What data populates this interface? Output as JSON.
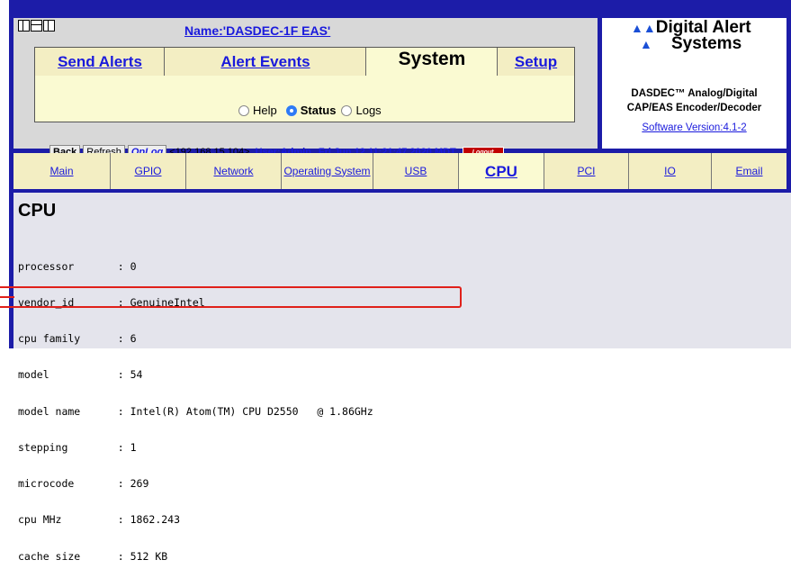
{
  "header": {
    "name_link": "Name:'DASDEC-1F EAS'",
    "tabs": [
      {
        "label": "Send Alerts",
        "selected": false
      },
      {
        "label": "Alert Events",
        "selected": false
      },
      {
        "label": "System",
        "selected": true
      },
      {
        "label": "Setup",
        "selected": false
      }
    ],
    "radios": [
      {
        "label": "Help",
        "checked": false
      },
      {
        "label": "Status",
        "checked": true
      },
      {
        "label": "Logs",
        "checked": false
      }
    ],
    "nav": {
      "back": "Back",
      "refresh": "Refresh",
      "oplog": "OpLog",
      "ip": "<192.168.15.104>",
      "user": "User:Admin",
      "datetime": "Fri Jun 12 11:21:47 2020 MDT",
      "logout": "Logout"
    }
  },
  "brand": {
    "logo_line1": "Digital Alert",
    "logo_line2": "Systems",
    "product_line1": "DASDEC™ Analog/Digital",
    "product_line2": "CAP/EAS Encoder/Decoder",
    "version": "Software Version:4.1-2"
  },
  "subnav": {
    "items": [
      {
        "label": "Main"
      },
      {
        "label": "GPIO"
      },
      {
        "label": "Network"
      },
      {
        "label": "Operating System"
      },
      {
        "label": "USB"
      },
      {
        "label": "CPU",
        "selected": true
      },
      {
        "label": "PCI"
      },
      {
        "label": "IO"
      },
      {
        "label": "Email"
      }
    ]
  },
  "content": {
    "title": "CPU",
    "lines": [
      "processor       : 0",
      "vendor_id       : GenuineIntel",
      "cpu family      : 6",
      "model           : 54",
      "model name      : Intel(R) Atom(TM) CPU D2550   @ 1.86GHz",
      "stepping        : 1",
      "microcode       : 269",
      "cpu MHz         : 1862.243",
      "cache size      : 512 KB"
    ]
  },
  "colors": {
    "frame_blue": "#1c1ca8",
    "link_blue": "#1a1adc",
    "tab_bg": "#f3eec3",
    "highlight_red": "#e0201a"
  }
}
